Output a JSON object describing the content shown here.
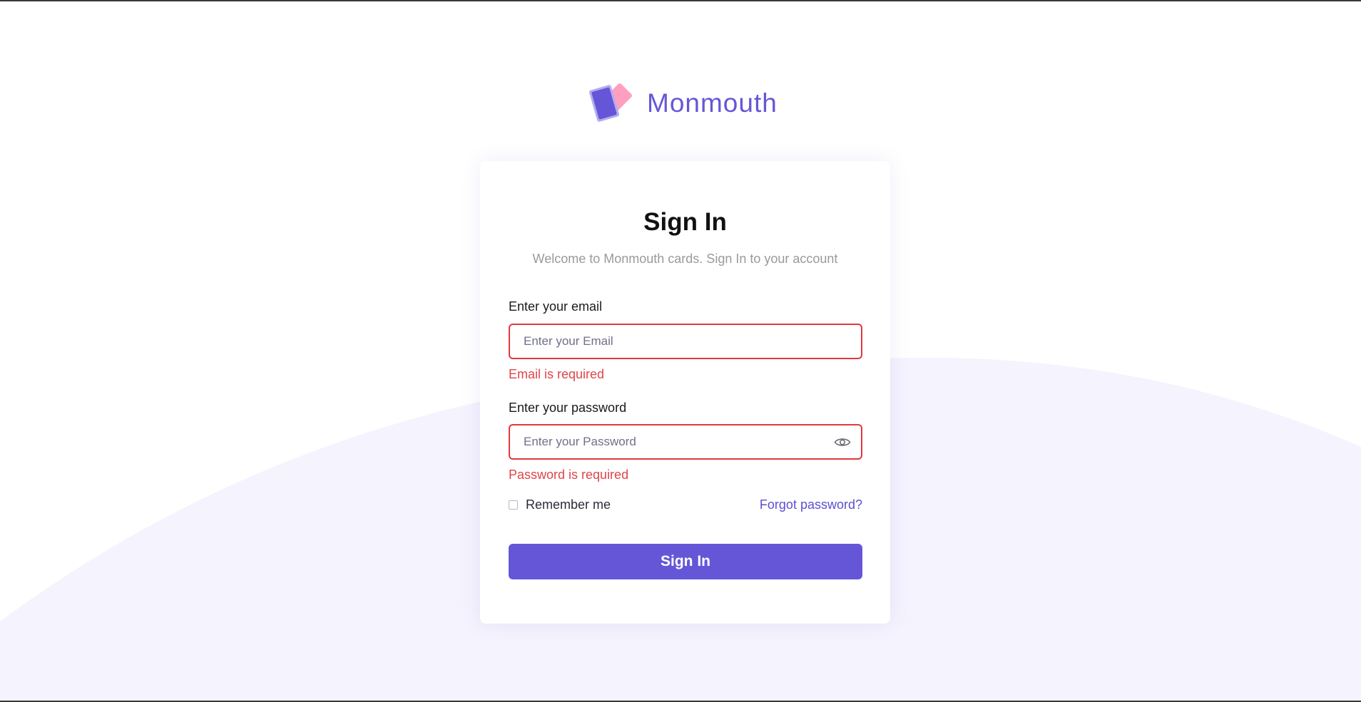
{
  "brand": {
    "name": "Monmouth",
    "logo_icon": "cards-logo-icon",
    "color": "#6556d8"
  },
  "form": {
    "title": "Sign In",
    "subtitle": "Welcome to Monmouth cards. Sign In to your account",
    "email": {
      "label": "Enter your email",
      "placeholder": "Enter your Email",
      "value": "",
      "error": "Email is required"
    },
    "password": {
      "label": "Enter your password",
      "placeholder": "Enter your Password",
      "value": "",
      "error": "Password is required",
      "toggle_icon": "eye-icon"
    },
    "remember_label": "Remember me",
    "remember_checked": false,
    "forgot_label": "Forgot password?",
    "submit_label": "Sign In"
  },
  "colors": {
    "accent": "#6556d8",
    "error": "#e0444a",
    "background_arc": "#f4f3fe"
  }
}
